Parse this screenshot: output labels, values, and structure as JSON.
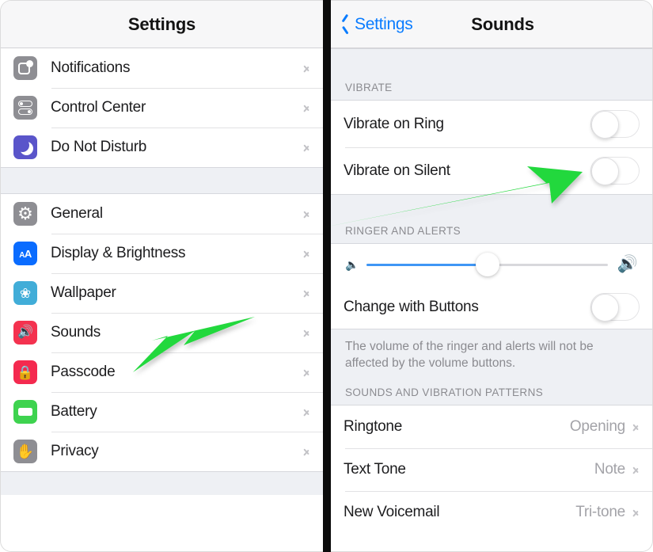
{
  "left_panel": {
    "title": "Settings",
    "groups": [
      {
        "items": [
          {
            "label": "Notifications",
            "icon": "notifications-icon",
            "color": "#8e8e93"
          },
          {
            "label": "Control Center",
            "icon": "control-center-icon",
            "color": "#8e8e93"
          },
          {
            "label": "Do Not Disturb",
            "icon": "moon-icon",
            "color": "#5a55ca"
          }
        ]
      },
      {
        "items": [
          {
            "label": "General",
            "icon": "gear-icon",
            "color": "#8e8e93"
          },
          {
            "label": "Display & Brightness",
            "icon": "text-size-icon",
            "color": "#0a6cff"
          },
          {
            "label": "Wallpaper",
            "icon": "flower-icon",
            "color": "#41add8"
          },
          {
            "label": "Sounds",
            "icon": "speaker-icon",
            "color": "#f4324f"
          },
          {
            "label": "Passcode",
            "icon": "lock-icon",
            "color": "#f42a4f"
          },
          {
            "label": "Battery",
            "icon": "battery-icon",
            "color": "#3ed34f"
          },
          {
            "label": "Privacy",
            "icon": "hand-icon",
            "color": "#8e8e93"
          }
        ]
      }
    ]
  },
  "right_panel": {
    "back_label": "Settings",
    "title": "Sounds",
    "sections": [
      {
        "header": "VIBRATE",
        "rows": [
          {
            "label": "Vibrate on Ring",
            "control": "toggle",
            "value": "off"
          },
          {
            "label": "Vibrate on Silent",
            "control": "toggle",
            "value": "off"
          }
        ]
      },
      {
        "header": "RINGER AND ALERTS",
        "slider": {
          "value": 50,
          "min_icon": "speaker-low-icon",
          "max_icon": "speaker-high-icon"
        },
        "rows": [
          {
            "label": "Change with Buttons",
            "control": "toggle",
            "value": "off"
          }
        ],
        "footer": "The volume of the ringer and alerts will not be affected by the volume buttons."
      },
      {
        "header": "SOUNDS AND VIBRATION PATTERNS",
        "rows": [
          {
            "label": "Ringtone",
            "control": "disclosure",
            "value": "Opening"
          },
          {
            "label": "Text Tone",
            "control": "disclosure",
            "value": "Note"
          },
          {
            "label": "New Voicemail",
            "control": "disclosure",
            "value": "Tri-tone"
          }
        ]
      }
    ]
  },
  "annotations": {
    "arrow_color": "#22d83c",
    "arrows": [
      {
        "name": "arrow-pointing-to-sounds",
        "target": "Sounds"
      },
      {
        "name": "arrow-pointing-to-vibrate-on-silent-toggle",
        "target": "Vibrate on Silent"
      }
    ]
  }
}
